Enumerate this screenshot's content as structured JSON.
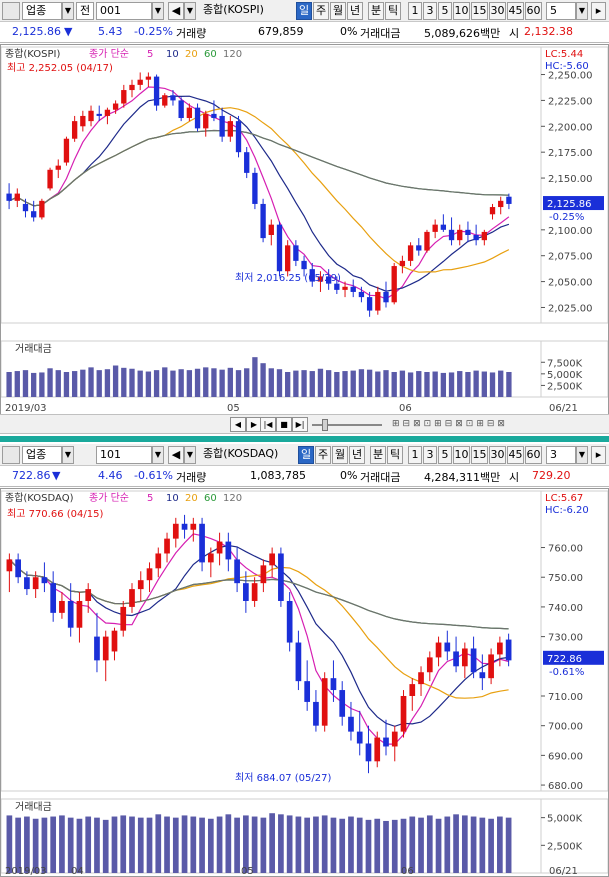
{
  "toolbar": {
    "category": "업종",
    "market_code": "전",
    "index_code": "001",
    "index_name": "종합(KOSPI)",
    "period_tabs": [
      "일",
      "주",
      "월",
      "년",
      "분",
      "틱"
    ],
    "selected_tab": "일",
    "interval_buttons": [
      "1",
      "3",
      "5",
      "10",
      "15",
      "30",
      "45",
      "60"
    ],
    "interval_value": "5"
  },
  "toolbar2": {
    "category": "업종",
    "index_code": "101",
    "index_name": "종합(KOSDAQ)",
    "interval_value": "3"
  },
  "quote": {
    "price": "2,125.86",
    "arrow": "▼",
    "change": "5.43",
    "change_pct": "-0.25%",
    "volume_label": "거래량",
    "volume": "679,859",
    "zero_pct": "0%",
    "amount_label": "거래대금",
    "amount": "5,089,626백만",
    "high_label": "시",
    "open_price": "2,132.38"
  },
  "quote2": {
    "price": "722.86",
    "arrow": "▼",
    "change": "4.46",
    "change_pct": "-0.61%",
    "volume_label": "거래량",
    "volume": "1,083,785",
    "zero_pct": "0%",
    "amount_label": "거래대금",
    "amount": "4,284,311백만",
    "high_label": "시",
    "open_price": "729.20"
  },
  "colors": {
    "up": "#e01010",
    "down": "#1a2fd8",
    "ma5": "#d61fb2",
    "ma10": "#1e2a8a",
    "ma20": "#e8a010",
    "ma60": "#2b9a3a",
    "ma120": "#707070",
    "volume": "#5a5aa8",
    "accent": "#2a67c5"
  },
  "icons": [
    "speaker-icon",
    "scroll-left-icon",
    "scroll-right-icon",
    "zoom-icon"
  ],
  "kospi_chart": {
    "legend_name": "종합(KOSPI)",
    "legend_ma_label": "종가 단순",
    "legend_ma": [
      "5",
      "10",
      "20",
      "60",
      "120"
    ],
    "lc": "LC:5.44",
    "hc": "HC:-5.60",
    "current_price": "2,125.86",
    "current_pct": "-0.25%",
    "high_annot": "최고 2,252.05 (04/17)",
    "low_annot": "최저 2,016.25 (05/29)",
    "yticks": [
      "2,250.00",
      "2,225.00",
      "2,200.00",
      "2,175.00",
      "2,150.00",
      "2,100.00",
      "2,075.00",
      "2,050.00",
      "2,025.00"
    ],
    "volume_title": "거래대금",
    "volume_ticks": [
      "7,500K",
      "5,000K",
      "2,500K"
    ],
    "x_labels": [
      "2019/03",
      "05",
      "06",
      "06/21"
    ]
  },
  "kosdaq_chart": {
    "legend_name": "종합(KOSDAQ)",
    "legend_ma_label": "종가 단순",
    "legend_ma": [
      "5",
      "10",
      "20",
      "60",
      "120"
    ],
    "lc": "LC:5.67",
    "hc": "HC:-6.20",
    "current_price": "722.86",
    "current_pct": "-0.61%",
    "high_annot": "최고 770.66 (04/15)",
    "low_annot": "최저 684.07 (05/27)",
    "yticks": [
      "760.00",
      "750.00",
      "740.00",
      "730.00",
      "710.00",
      "700.00",
      "690.00",
      "680.00"
    ],
    "volume_title": "거래대금",
    "volume_ticks": [
      "5,000K",
      "2,500K"
    ],
    "x_labels": [
      "2019/03",
      "04",
      "05",
      "06",
      "06/21"
    ]
  },
  "chart_data": [
    {
      "type": "candlestick",
      "title": "종합(KOSPI)",
      "ylim": [
        2010,
        2265
      ],
      "candles": [
        [
          2135,
          2145,
          2120,
          2128
        ],
        [
          2128,
          2140,
          2122,
          2135
        ],
        [
          2125,
          2130,
          2112,
          2118
        ],
        [
          2118,
          2128,
          2108,
          2112
        ],
        [
          2112,
          2130,
          2110,
          2128
        ],
        [
          2140,
          2160,
          2138,
          2158
        ],
        [
          2158,
          2168,
          2150,
          2162
        ],
        [
          2165,
          2190,
          2162,
          2188
        ],
        [
          2188,
          2210,
          2185,
          2205
        ],
        [
          2200,
          2215,
          2195,
          2210
        ],
        [
          2205,
          2220,
          2200,
          2215
        ],
        [
          2212,
          2220,
          2205,
          2210
        ],
        [
          2210,
          2218,
          2202,
          2216
        ],
        [
          2216,
          2225,
          2212,
          2222
        ],
        [
          2222,
          2240,
          2218,
          2235
        ],
        [
          2235,
          2245,
          2228,
          2240
        ],
        [
          2240,
          2252,
          2235,
          2245
        ],
        [
          2245,
          2252,
          2238,
          2248
        ],
        [
          2248,
          2250,
          2215,
          2220
        ],
        [
          2220,
          2232,
          2218,
          2230
        ],
        [
          2230,
          2235,
          2220,
          2225
        ],
        [
          2225,
          2228,
          2205,
          2208
        ],
        [
          2208,
          2222,
          2205,
          2218
        ],
        [
          2218,
          2222,
          2195,
          2198
        ],
        [
          2198,
          2215,
          2190,
          2212
        ],
        [
          2212,
          2225,
          2205,
          2208
        ],
        [
          2210,
          2218,
          2185,
          2190
        ],
        [
          2190,
          2210,
          2185,
          2205
        ],
        [
          2205,
          2210,
          2170,
          2175
        ],
        [
          2175,
          2180,
          2150,
          2155
        ],
        [
          2155,
          2160,
          2120,
          2125
        ],
        [
          2125,
          2130,
          2088,
          2092
        ],
        [
          2095,
          2110,
          2085,
          2105
        ],
        [
          2105,
          2108,
          2055,
          2060
        ],
        [
          2060,
          2090,
          2055,
          2085
        ],
        [
          2085,
          2090,
          2065,
          2070
        ],
        [
          2070,
          2075,
          2055,
          2062
        ],
        [
          2062,
          2068,
          2045,
          2050
        ],
        [
          2050,
          2060,
          2040,
          2055
        ],
        [
          2055,
          2062,
          2042,
          2048
        ],
        [
          2048,
          2055,
          2038,
          2042
        ],
        [
          2042,
          2050,
          2035,
          2045
        ],
        [
          2045,
          2052,
          2035,
          2040
        ],
        [
          2040,
          2045,
          2030,
          2035
        ],
        [
          2035,
          2040,
          2016,
          2022
        ],
        [
          2022,
          2045,
          2018,
          2040
        ],
        [
          2040,
          2050,
          2025,
          2030
        ],
        [
          2030,
          2068,
          2028,
          2065
        ],
        [
          2065,
          2075,
          2058,
          2070
        ],
        [
          2070,
          2088,
          2065,
          2085
        ],
        [
          2085,
          2092,
          2075,
          2080
        ],
        [
          2080,
          2100,
          2078,
          2098
        ],
        [
          2098,
          2110,
          2092,
          2105
        ],
        [
          2105,
          2115,
          2098,
          2100
        ],
        [
          2100,
          2112,
          2085,
          2090
        ],
        [
          2090,
          2105,
          2085,
          2100
        ],
        [
          2100,
          2108,
          2088,
          2095
        ],
        [
          2095,
          2105,
          2085,
          2090
        ],
        [
          2090,
          2100,
          2085,
          2098
        ],
        [
          2115,
          2125,
          2110,
          2122
        ],
        [
          2122,
          2132,
          2115,
          2128
        ],
        [
          2132,
          2135,
          2120,
          2125
        ]
      ],
      "volume_k": [
        5400,
        5600,
        5800,
        5200,
        5300,
        6200,
        5800,
        5400,
        5600,
        5900,
        6400,
        5800,
        6000,
        6800,
        6300,
        6100,
        5700,
        5500,
        5800,
        6400,
        5700,
        6000,
        5800,
        6100,
        6400,
        6200,
        5900,
        6300,
        5800,
        6200,
        8600,
        7300,
        6200,
        6000,
        5400,
        5700,
        5800,
        5600,
        6100,
        5800,
        5400,
        5600,
        5700,
        6000,
        5900,
        5500,
        5800,
        5400,
        5700,
        5300,
        5600,
        5400,
        5500,
        5200,
        5300,
        5600,
        5400,
        5700,
        5500,
        5300,
        5700,
        5400
      ],
      "volume_ticks": [
        7500,
        5000,
        2500
      ],
      "xlabel": "",
      "ylabel": ""
    },
    {
      "type": "candlestick",
      "title": "종합(KOSDAQ)",
      "ylim": [
        678,
        775
      ],
      "candles": [
        [
          752,
          758,
          745,
          756
        ],
        [
          756,
          758,
          748,
          750
        ],
        [
          750,
          752,
          744,
          746
        ],
        [
          746,
          752,
          743,
          750
        ],
        [
          750,
          755,
          745,
          748
        ],
        [
          748,
          752,
          735,
          738
        ],
        [
          738,
          745,
          736,
          742
        ],
        [
          742,
          748,
          730,
          733
        ],
        [
          733,
          745,
          728,
          742
        ],
        [
          742,
          748,
          738,
          746
        ],
        [
          730,
          738,
          718,
          722
        ],
        [
          722,
          732,
          715,
          730
        ],
        [
          725,
          733,
          722,
          732
        ],
        [
          732,
          742,
          730,
          740
        ],
        [
          740,
          748,
          738,
          746
        ],
        [
          746,
          752,
          742,
          749
        ],
        [
          749,
          755,
          745,
          753
        ],
        [
          753,
          760,
          750,
          758
        ],
        [
          758,
          765,
          755,
          763
        ],
        [
          763,
          770,
          760,
          768
        ],
        [
          768,
          771,
          763,
          766
        ],
        [
          766,
          770,
          762,
          768
        ],
        [
          768,
          770,
          752,
          755
        ],
        [
          755,
          760,
          750,
          758
        ],
        [
          758,
          765,
          754,
          762
        ],
        [
          762,
          765,
          752,
          756
        ],
        [
          756,
          760,
          745,
          748
        ],
        [
          748,
          752,
          738,
          742
        ],
        [
          742,
          750,
          740,
          748
        ],
        [
          748,
          756,
          745,
          754
        ],
        [
          754,
          760,
          750,
          758
        ],
        [
          758,
          760,
          740,
          742
        ],
        [
          742,
          745,
          725,
          728
        ],
        [
          728,
          732,
          712,
          715
        ],
        [
          715,
          722,
          705,
          708
        ],
        [
          708,
          712,
          698,
          700
        ],
        [
          700,
          718,
          698,
          716
        ],
        [
          716,
          722,
          708,
          712
        ],
        [
          712,
          715,
          700,
          703
        ],
        [
          703,
          708,
          695,
          698
        ],
        [
          698,
          705,
          690,
          694
        ],
        [
          694,
          700,
          684,
          688
        ],
        [
          688,
          698,
          686,
          696
        ],
        [
          696,
          702,
          690,
          693
        ],
        [
          693,
          700,
          688,
          698
        ],
        [
          698,
          712,
          696,
          710
        ],
        [
          710,
          716,
          705,
          714
        ],
        [
          714,
          720,
          710,
          718
        ],
        [
          718,
          725,
          715,
          723
        ],
        [
          723,
          730,
          720,
          728
        ],
        [
          728,
          732,
          722,
          725
        ],
        [
          725,
          730,
          718,
          720
        ],
        [
          720,
          728,
          716,
          726
        ],
        [
          726,
          730,
          716,
          718
        ],
        [
          718,
          724,
          712,
          716
        ],
        [
          716,
          726,
          714,
          724
        ],
        [
          724,
          730,
          720,
          728
        ],
        [
          729,
          731,
          720,
          722
        ]
      ],
      "volume_k": [
        5200,
        5000,
        5100,
        4900,
        5000,
        5100,
        5200,
        5000,
        4900,
        5100,
        5000,
        4800,
        5100,
        5200,
        5100,
        5000,
        5000,
        5300,
        5100,
        5000,
        5200,
        5100,
        5000,
        4900,
        5100,
        5300,
        5000,
        5200,
        5100,
        5000,
        5400,
        5300,
        5200,
        5100,
        5000,
        5100,
        5200,
        5000,
        4900,
        5100,
        5000,
        4800,
        4900,
        4700,
        4800,
        4900,
        5100,
        5000,
        5200,
        4900,
        5100,
        5300,
        5200,
        5100,
        5000,
        4900,
        5100,
        5000
      ],
      "volume_ticks": [
        5000,
        2500
      ],
      "xlabel": "",
      "ylabel": ""
    }
  ]
}
